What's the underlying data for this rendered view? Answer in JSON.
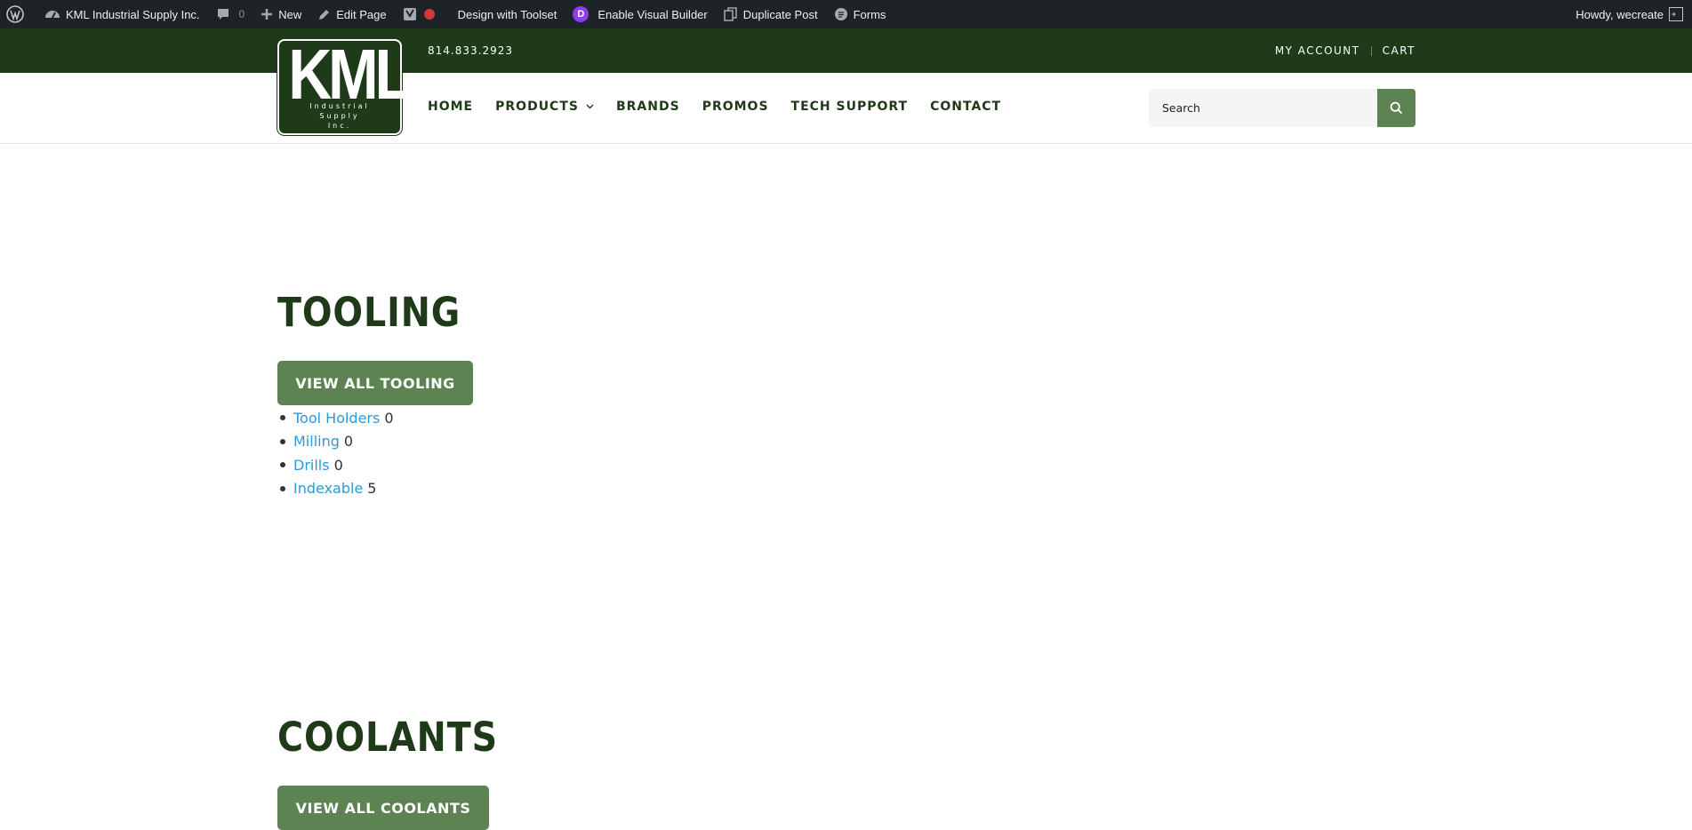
{
  "adminbar": {
    "site_name": "KML Industrial Supply Inc.",
    "comments_count": "0",
    "new_label": "New",
    "edit_label": "Edit Page",
    "toolset_label": "Design with Toolset",
    "visual_builder_label": "Enable Visual Builder",
    "duplicate_label": "Duplicate Post",
    "forms_label": "Forms",
    "howdy_label": "Howdy, wecreate",
    "divi_letter": "D"
  },
  "topbar": {
    "phone": "814.833.2923",
    "my_account": "MY ACCOUNT",
    "cart": "CART"
  },
  "logo": {
    "main": "KML",
    "line1": "Industrial",
    "line2": "Supply",
    "line3": "Inc."
  },
  "nav": {
    "items": [
      "HOME",
      "PRODUCTS",
      "BRANDS",
      "PROMOS",
      "TECH SUPPORT",
      "CONTACT"
    ]
  },
  "search": {
    "placeholder": "Search"
  },
  "sections": [
    {
      "title": "TOOLING",
      "button": "VIEW ALL TOOLING",
      "categories": [
        {
          "name": "Tool Holders",
          "count": "0"
        },
        {
          "name": "Milling",
          "count": "0"
        },
        {
          "name": "Drills",
          "count": "0"
        },
        {
          "name": "Indexable",
          "count": "5"
        }
      ]
    },
    {
      "title": "COOLANTS",
      "button": "VIEW ALL COOLANTS"
    }
  ],
  "colors": {
    "brand_dark_green": "#1e3a18",
    "button_green": "#5e8353",
    "link_blue": "#2b9ad8",
    "adminbar_bg": "#1d2327"
  }
}
